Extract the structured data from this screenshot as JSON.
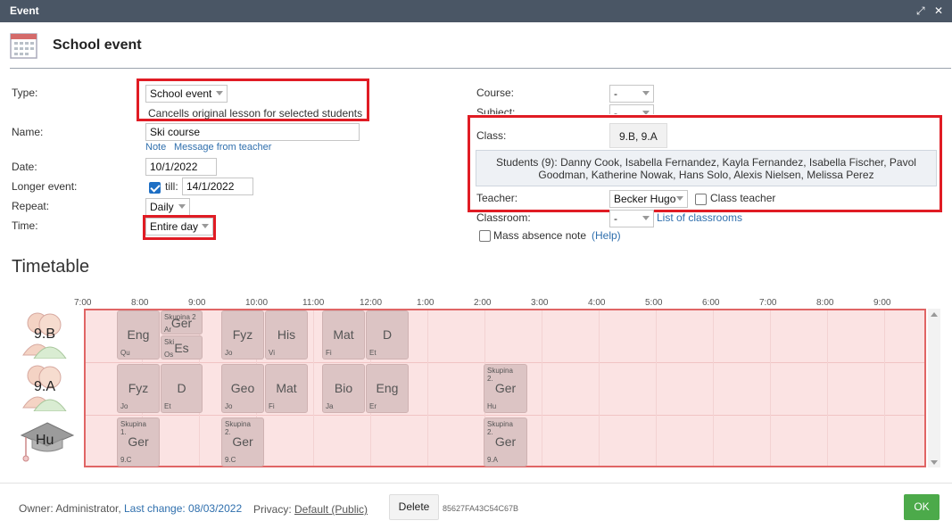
{
  "window": {
    "title": "Event"
  },
  "header": {
    "title": "School event"
  },
  "form": {
    "type_label": "Type:",
    "type_value": "School event",
    "type_note": "Cancells original lesson for selected students",
    "name_label": "Name:",
    "name_value": "Ski course",
    "note_link": "Note",
    "message_link": "Message from teacher",
    "date_label": "Date:",
    "date_value": "10/1/2022",
    "longer_label": "Longer event:",
    "till_label": "till:",
    "till_value": "14/1/2022",
    "repeat_label": "Repeat:",
    "repeat_value": "Daily",
    "time_label": "Time:",
    "time_value": "Entire day"
  },
  "right": {
    "course_label": "Course:",
    "course_value": "-",
    "subject_label": "Subject:",
    "subject_value": "-",
    "class_label": "Class:",
    "class_value": "9.B, 9.A",
    "students_text": "Students (9): Danny Cook, Isabella Fernandez, Kayla Fernandez, Isabella Fischer, Pavol Goodman, Katherine Nowak, Hans Solo, Alexis Nielsen, Melissa Perez",
    "teacher_label": "Teacher:",
    "teacher_value": "Becker Hugo",
    "class_teacher_label": "Class teacher",
    "classroom_label": "Classroom:",
    "classroom_value": "-",
    "list_classrooms_link": "List of classrooms",
    "mass_absence_label": "Mass absence note",
    "help_link": "(Help)"
  },
  "timetable": {
    "title": "Timetable",
    "hours": [
      "7:00",
      "8:00",
      "9:00",
      "10:00",
      "11:00",
      "12:00",
      "1:00",
      "2:00",
      "3:00",
      "4:00",
      "5:00",
      "6:00",
      "7:00",
      "8:00",
      "9:00"
    ],
    "rows": [
      {
        "label": "9.B",
        "icon": "students-icon"
      },
      {
        "label": "9.A",
        "icon": "students-icon"
      },
      {
        "label": "Hu",
        "icon": "graduation-cap-icon"
      }
    ],
    "lessons": {
      "r0_eng": {
        "name": "Eng",
        "teacher": "Qu"
      },
      "r0_ger": {
        "group": "Skupina 2",
        "name": "Ger",
        "teacher": "Ar"
      },
      "r0_es": {
        "group": "Ski",
        "name": "Es",
        "teacher": "Os"
      },
      "r0_fyz": {
        "name": "Fyz",
        "teacher": "Jo"
      },
      "r0_his": {
        "name": "His",
        "teacher": "Vi"
      },
      "r0_mat": {
        "name": "Mat",
        "teacher": "Fi"
      },
      "r0_d": {
        "name": "D",
        "teacher": "Et"
      },
      "r1_fyz": {
        "name": "Fyz",
        "teacher": "Jo"
      },
      "r1_d": {
        "name": "D",
        "teacher": "Et"
      },
      "r1_geo": {
        "name": "Geo",
        "teacher": "Jo"
      },
      "r1_mat": {
        "name": "Mat",
        "teacher": "Fi"
      },
      "r1_bio": {
        "name": "Bio",
        "teacher": "Ja"
      },
      "r1_eng": {
        "name": "Eng",
        "teacher": "Er"
      },
      "r1_ger": {
        "group": "Skupina 2.",
        "name": "Ger",
        "teacher": "Hu"
      },
      "r2_ger1": {
        "group": "Skupina 1.",
        "name": "Ger",
        "teacher": "9.C"
      },
      "r2_ger2": {
        "group": "Skupina 2.",
        "name": "Ger",
        "teacher": "9.C"
      },
      "r2_ger3": {
        "group": "Skupina 2.",
        "name": "Ger",
        "teacher": "9.A"
      }
    }
  },
  "footer": {
    "owner": "Owner: Administrator,",
    "last_change": "Last change: 08/03/2022",
    "privacy_label": "Privacy:",
    "privacy_value": "Default (Public)",
    "delete": "Delete",
    "id_code": "85627FA43C54C67B",
    "ok": "OK"
  }
}
